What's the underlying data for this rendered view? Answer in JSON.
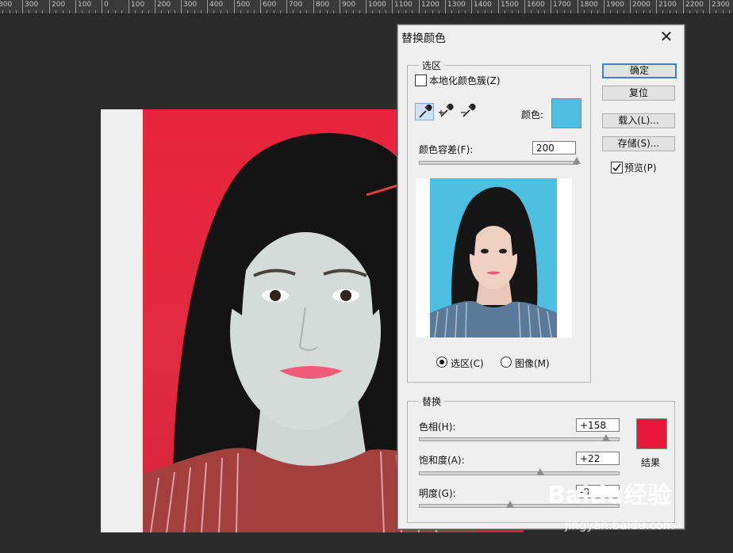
{
  "ruler": {
    "ticks": [
      "300",
      "300",
      "200",
      "100",
      "0",
      "100",
      "200",
      "300",
      "400",
      "500",
      "600",
      "700",
      "800",
      "900",
      "1000",
      "1100",
      "1200",
      "1300",
      "1400",
      "1500",
      "1600",
      "1700",
      "1800",
      "1900",
      "2000",
      "2100",
      "2200",
      "2300"
    ]
  },
  "dialog": {
    "title": "替换颜色",
    "close_icon": "close-icon",
    "selection": {
      "legend": "选区",
      "localized_label": "本地化颜色簇(Z)",
      "localized_checked": false,
      "color_label": "颜色:",
      "color": "#4dbfe0",
      "fuzziness_label": "颜色容差(F):",
      "fuzziness_value": "200",
      "fuzziness_level": 1.0,
      "radio_selection": "选区(C)",
      "radio_image": "图像(M)",
      "radio_selected": "selection"
    },
    "buttons": {
      "ok": "确定",
      "reset": "复位",
      "load": "载入(L)...",
      "save": "存储(S)..."
    },
    "preview_label": "预览(P)",
    "preview_checked": true,
    "replace": {
      "legend": "替换",
      "hue_label": "色相(H):",
      "hue_value": "+158",
      "hue_level": 0.94,
      "saturation_label": "饱和度(A):",
      "saturation_value": "+22",
      "saturation_level": 0.61,
      "lightness_label": "明度(G):",
      "lightness_value": "-8",
      "lightness_level": 0.46,
      "result_label": "结果",
      "result_color": "#e8173a"
    }
  },
  "colors": {
    "photo_background": "#e8243c",
    "preview_background": "#4dbfe0",
    "arrow": "#e8403a",
    "accent": "#3c7fd0"
  },
  "watermark": {
    "brand": "Baidu经验",
    "url": "jingyan.baidu.com"
  }
}
